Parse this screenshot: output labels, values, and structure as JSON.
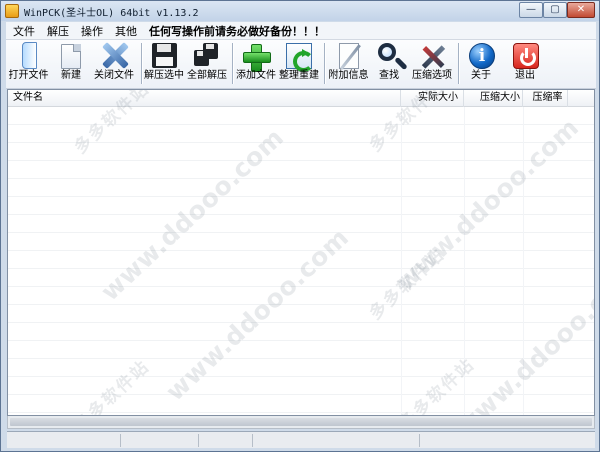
{
  "window": {
    "title": "WinPCK(圣斗士OL) 64bit v1.13.2",
    "controls": {
      "minimize": "—",
      "maximize": "▢",
      "close": "✕"
    }
  },
  "menu": {
    "items": [
      {
        "label": "文件"
      },
      {
        "label": "解压"
      },
      {
        "label": "操作"
      },
      {
        "label": "其他"
      }
    ],
    "warning": "任何写操作前请务必做好备份！！！"
  },
  "toolbar": {
    "buttons": [
      {
        "label": "打开文件",
        "icon": "open-file-icon"
      },
      {
        "label": "新建",
        "icon": "new-file-icon"
      },
      {
        "label": "关闭文件",
        "icon": "close-file-icon"
      },
      {
        "label": "解压选中",
        "icon": "extract-selected-icon"
      },
      {
        "label": "全部解压",
        "icon": "extract-all-icon"
      },
      {
        "label": "添加文件",
        "icon": "add-file-icon"
      },
      {
        "label": "整理重建",
        "icon": "rebuild-icon"
      },
      {
        "label": "附加信息",
        "icon": "additional-info-icon"
      },
      {
        "label": "查找",
        "icon": "search-icon"
      },
      {
        "label": "压缩选项",
        "icon": "compression-options-icon"
      },
      {
        "label": "关于",
        "icon": "about-icon"
      },
      {
        "label": "退出",
        "icon": "exit-icon"
      }
    ]
  },
  "file_list": {
    "columns": [
      {
        "label": "文件名"
      },
      {
        "label": "实际大小"
      },
      {
        "label": "压缩大小"
      },
      {
        "label": "压缩率"
      }
    ],
    "rows": []
  },
  "watermark": {
    "url": "www.ddooo.com",
    "site": "多多软件站"
  },
  "colors": {
    "frame": "#cfdbe9",
    "toolbar": "#f6f8fb",
    "selection_grid": "#f0f2f4"
  }
}
